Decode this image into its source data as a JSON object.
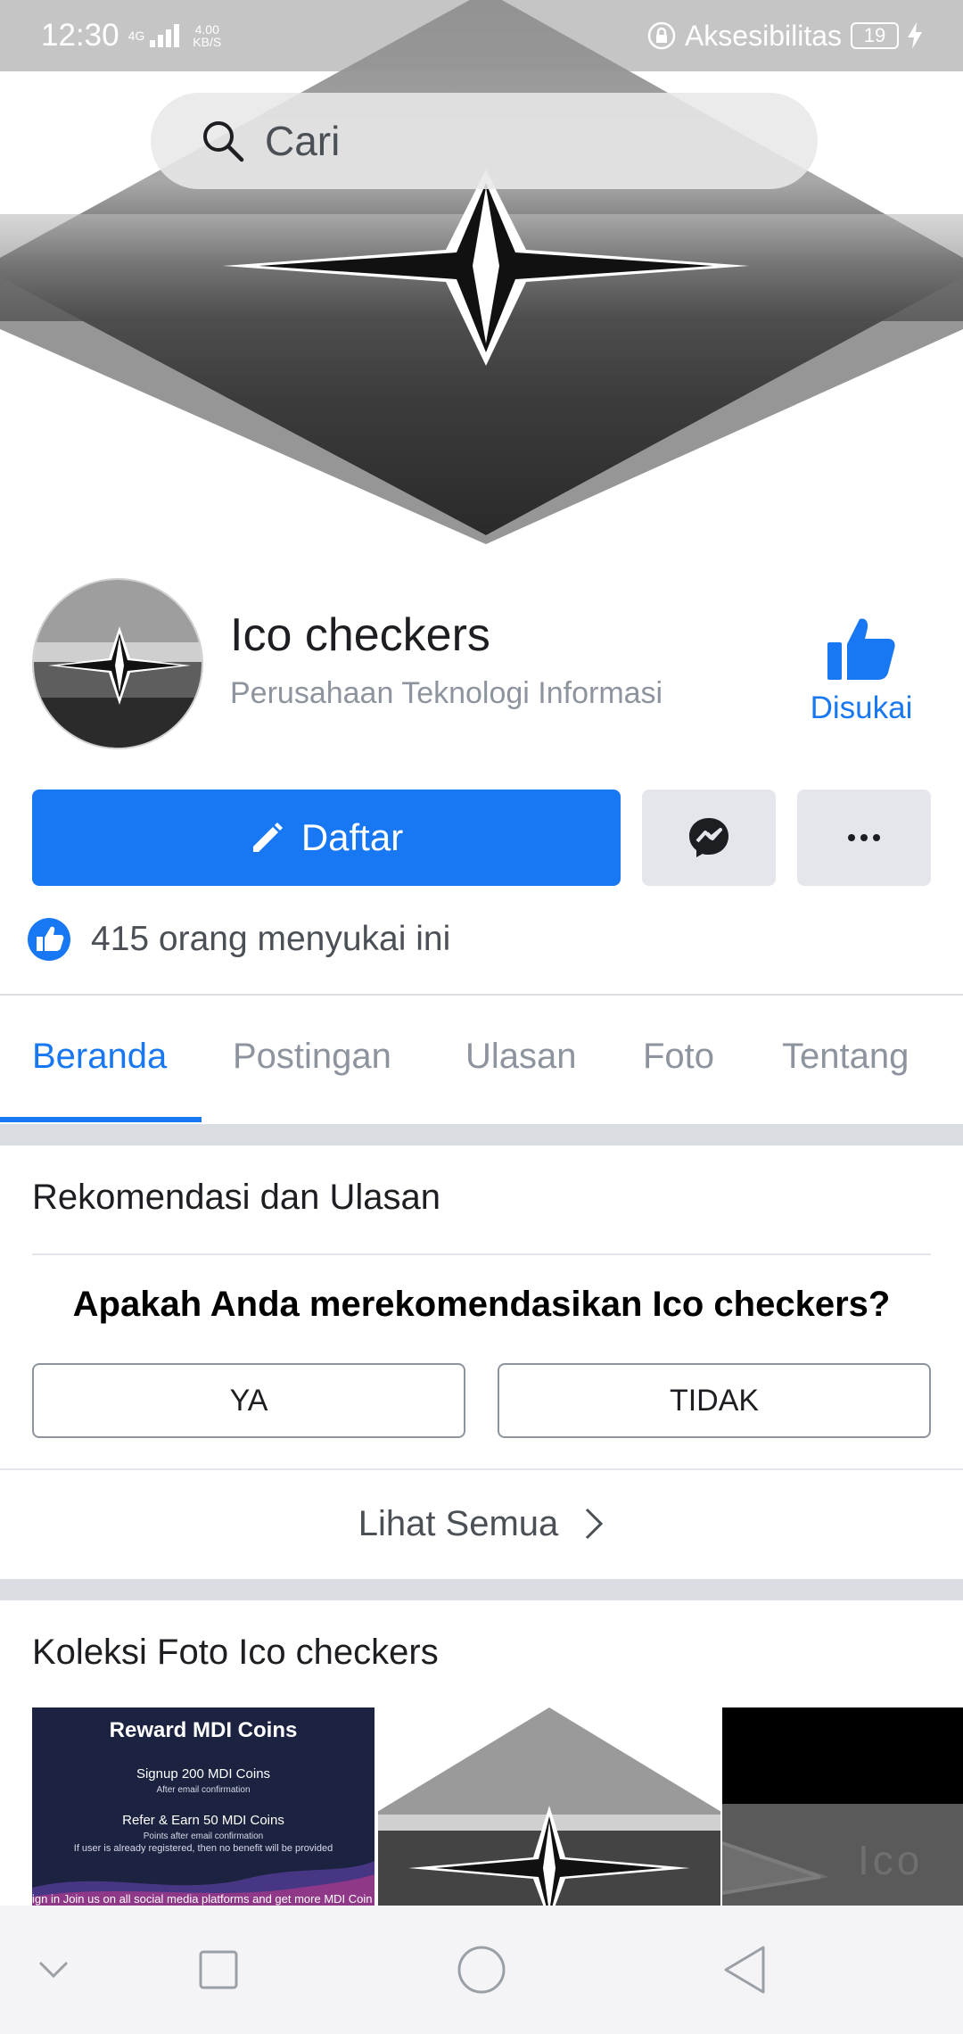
{
  "status_bar": {
    "time": "12:30",
    "network": "4G",
    "speed_value": "4.00",
    "speed_unit": "KB/S",
    "accessibility": "Aksesibilitas",
    "battery": "19"
  },
  "search": {
    "placeholder": "Cari"
  },
  "page": {
    "name": "Ico checkers",
    "category": "Perusahaan Teknologi Informasi",
    "like_label": "Disukai"
  },
  "actions": {
    "primary_label": "Daftar"
  },
  "likes": {
    "text": "415 orang menyukai ini"
  },
  "tabs": [
    {
      "label": "Beranda",
      "active": true
    },
    {
      "label": "Postingan",
      "active": false
    },
    {
      "label": "Ulasan",
      "active": false
    },
    {
      "label": "Foto",
      "active": false
    },
    {
      "label": "Tentang",
      "active": false
    }
  ],
  "recommendations": {
    "title": "Rekomendasi dan Ulasan",
    "question": "Apakah Anda merekomendasikan Ico checkers?",
    "yes_label": "YA",
    "no_label": "TIDAK",
    "see_all": "Lihat Semua"
  },
  "photos": {
    "title": "Koleksi Foto Ico checkers",
    "items": [
      {
        "title": "Reward MDI Coins",
        "line1": "Signup 200 MDI Coins",
        "line1_sub": "After email confirmation",
        "line2": "Refer & Earn 50 MDI Coins",
        "line2_sub": "Points after email confirmation",
        "note": "If user is already registered, then no benefit will be provided",
        "footer": "ign in Join us on all social media platforms and get more MDI Coin"
      },
      {
        "type": "logo"
      },
      {
        "caption": "Ico"
      }
    ]
  },
  "colors": {
    "facebook_blue": "#1877f2",
    "button_gray": "#e4e6eb",
    "divider": "#dadde1"
  }
}
